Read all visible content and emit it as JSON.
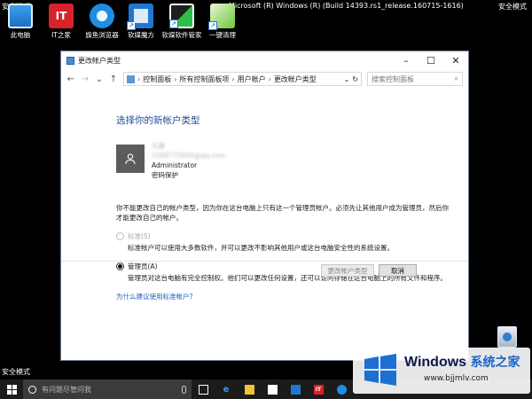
{
  "desktop": {
    "safe_mode_label": "安全模式",
    "build_text": "Microsoft (R) Windows (R) (Build 14393.rs1_release.160715-1616)",
    "icons": [
      {
        "label": "此电脑",
        "icon": "this-pc-icon"
      },
      {
        "label": "IT之家",
        "icon": "ithome-icon",
        "glyph": "IT"
      },
      {
        "label": "旗鱼浏览器",
        "icon": "browser-icon"
      },
      {
        "label": "软媒魔方",
        "icon": "ruanmei-magic-icon"
      },
      {
        "label": "软媒软件管家",
        "icon": "software-manager-icon"
      },
      {
        "label": "一键清理",
        "icon": "one-click-clean-icon"
      }
    ],
    "recycle_bin_icon": "recycle-bin-icon"
  },
  "window": {
    "title": "更改帐户类型",
    "address": {
      "breadcrumbs": [
        "控制面板",
        "所有控制面板项",
        "用户帐户",
        "更改帐户类型"
      ]
    },
    "search_placeholder": "搜索控制面板",
    "heading": "选择你的新帐户类型",
    "account": {
      "name": "乐趣",
      "email": "1588775649@qq.com",
      "role": "Administrator",
      "protection": "密码保护"
    },
    "note": "你不能更改自己的帐户类型，因为你在这台电脑上只有这一个管理员帐户。必须先让其他用户成为管理员，然后你才能更改自己的帐户。",
    "options": [
      {
        "label": "标准(S)",
        "desc": "标准帐户可以使用大多数软件，并可以更改不影响其他用户或这台电脑安全性的系统设置。",
        "selected": false,
        "disabled": true
      },
      {
        "label": "管理员(A)",
        "desc": "管理员对这台电脑有完全控制权。他们可以更改任何设置，还可以访问存储在这台电脑上的所有文件和程序。",
        "selected": true,
        "disabled": false
      }
    ],
    "link": "为什么建议使用标准帐户?",
    "buttons": {
      "change": "更改帐户类型",
      "cancel": "取消"
    }
  },
  "taskbar": {
    "search_placeholder": "有问题尽管问我",
    "apps": [
      "task-view-icon",
      "edge-icon",
      "file-explorer-icon",
      "store-icon",
      "ruanmei-icon",
      "ithome-taskbar-icon",
      "qiyu-browser-icon"
    ],
    "ithome_glyph": "IT"
  },
  "watermark": {
    "brand_en": "Windows",
    "brand_cn": "系统之家",
    "url": "www.bjjmlv.com"
  },
  "colors": {
    "accent": "#1e4e9c",
    "link": "#1e5fbf",
    "taskbar": "#1b1b1b"
  }
}
